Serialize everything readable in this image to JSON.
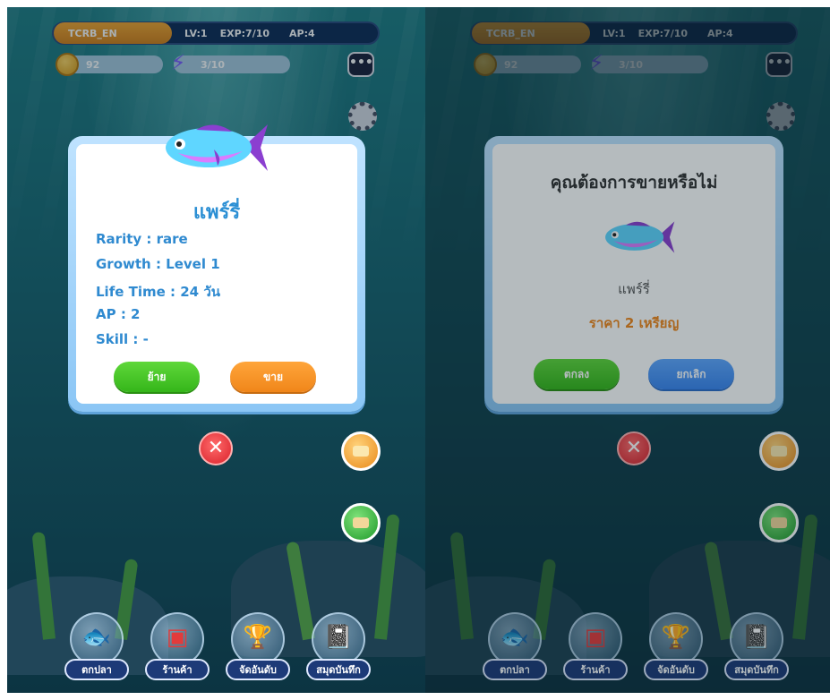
{
  "player": {
    "name": "TCRB_EN",
    "level": "LV:1",
    "exp": "EXP:7/10",
    "ap": "AP:4"
  },
  "resources": {
    "coins": "92",
    "energy": "3/10"
  },
  "colors": {
    "title_blue": "#2b8fd4",
    "price_orange": "#f0861a",
    "green_btn": "#35b61a",
    "orange_btn": "#f0861a",
    "blue_btn": "#3a85ee"
  },
  "left_modal": {
    "fish_name": "แพร์รี่",
    "rarity": "Rarity : rare",
    "growth": "Growth : Level 1",
    "life_time": "Life Time : 24 วัน",
    "ap": "AP : 2",
    "skill": "Skill : -",
    "move_button": "ย้าย",
    "sell_button": "ขาย"
  },
  "right_modal": {
    "question": "คุณต้องการขายหรือไม่",
    "fish_name": "แพร์รี่",
    "price": "ราคา 2 เหรียญ",
    "confirm_button": "ตกลง",
    "cancel_button": "ยกเลิก"
  },
  "bottom_nav": [
    {
      "label": "ตกปลา",
      "icon": "fishing-icon"
    },
    {
      "label": "ร้านค้า",
      "icon": "shop-icon"
    },
    {
      "label": "จัดอันดับ",
      "icon": "trophy-locked-icon"
    },
    {
      "label": "สมุดบันทึก",
      "icon": "notebook-locked-icon"
    }
  ]
}
